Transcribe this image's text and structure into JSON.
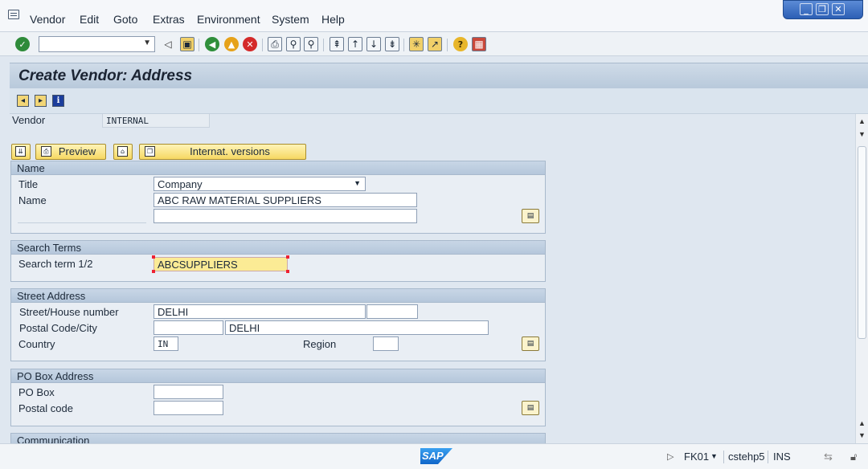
{
  "menu": [
    "Vendor",
    "Edit",
    "Goto",
    "Extras",
    "Environment",
    "System",
    "Help"
  ],
  "window_controls": [
    "minimize-icon",
    "restore-icon",
    "close-icon"
  ],
  "toolbar": {
    "command_field": "",
    "icons": [
      "check-icon",
      "back-triangle-icon",
      "save-icon",
      "back-icon",
      "exit-icon",
      "cancel-icon",
      "print-icon",
      "find-icon",
      "find-next-icon",
      "first-page-icon",
      "previous-page-icon",
      "next-page-icon",
      "last-page-icon",
      "new-session-icon",
      "shortcut-icon",
      "help-icon",
      "layout-icon"
    ]
  },
  "title": "Create Vendor: Address",
  "app_toolbar_icons": [
    "previous-screen-icon",
    "next-screen-icon",
    "info-icon"
  ],
  "vendor": {
    "label": "Vendor",
    "value": "INTERNAL"
  },
  "buttons": {
    "preview": "Preview",
    "intl_versions": "Internat. versions"
  },
  "name_group": {
    "header": "Name",
    "title_label": "Title",
    "title_value": "Company",
    "name_label": "Name",
    "name_value": "ABC RAW MATERIAL SUPPLIERS",
    "name2_value": ""
  },
  "search_group": {
    "header": "Search Terms",
    "label": "Search term 1/2",
    "value": "ABCSUPPLIERS"
  },
  "street_group": {
    "header": "Street Address",
    "street_label": "Street/House number",
    "street_value": "DELHI",
    "house_value": "",
    "postal_label": "Postal Code/City",
    "postal_value": "",
    "city_value": "DELHI",
    "country_label": "Country",
    "country_value": "IN",
    "region_label": "Region",
    "region_value": ""
  },
  "pobox_group": {
    "header": "PO Box Address",
    "pobox_label": "PO Box",
    "pobox_value": "",
    "postal_label": "Postal code",
    "postal_value": ""
  },
  "communication_group": {
    "header": "Communication"
  },
  "status": {
    "logo": "SAP",
    "transaction": "FK01",
    "server": "cstehp5",
    "mode": "INS"
  },
  "colors": {
    "title_bg": "#c4d3e4",
    "button_yellow": "#f6d862",
    "selected_field": "#fbeb95"
  }
}
